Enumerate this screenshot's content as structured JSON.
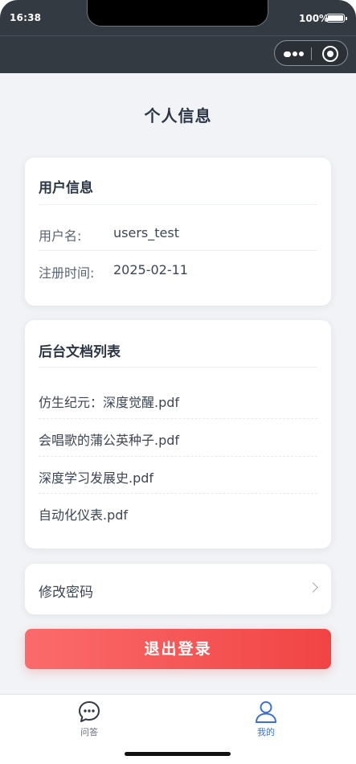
{
  "status_bar": {
    "time": "16:38",
    "battery_text": "100%"
  },
  "capsule": {
    "more_icon": "more-dots-icon",
    "close_icon": "target-circle-icon"
  },
  "page": {
    "title": "个人信息"
  },
  "user_card": {
    "heading": "用户信息",
    "rows": [
      {
        "label": "用户名:",
        "value": "users_test"
      },
      {
        "label": "注册时间:",
        "value": "2025-02-11"
      }
    ]
  },
  "docs_card": {
    "heading": "后台文档列表",
    "items": [
      "仿生纪元：深度觉醒.pdf",
      "会唱歌的蒲公英种子.pdf",
      "深度学习发展史.pdf",
      "自动化仪表.pdf"
    ]
  },
  "password_row": {
    "label": "修改密码",
    "icon": "chevron-right-icon"
  },
  "logout": {
    "label": "退出登录"
  },
  "tabbar": {
    "items": [
      {
        "label": "问答",
        "icon": "chat-bubble-icon",
        "active": false
      },
      {
        "label": "我的",
        "icon": "user-profile-icon",
        "active": true
      }
    ]
  },
  "colors": {
    "header": "#343a42",
    "accent_blue": "#3a6fd8",
    "logout_red": "#f14444",
    "page_bg": "#f1f3f6"
  }
}
